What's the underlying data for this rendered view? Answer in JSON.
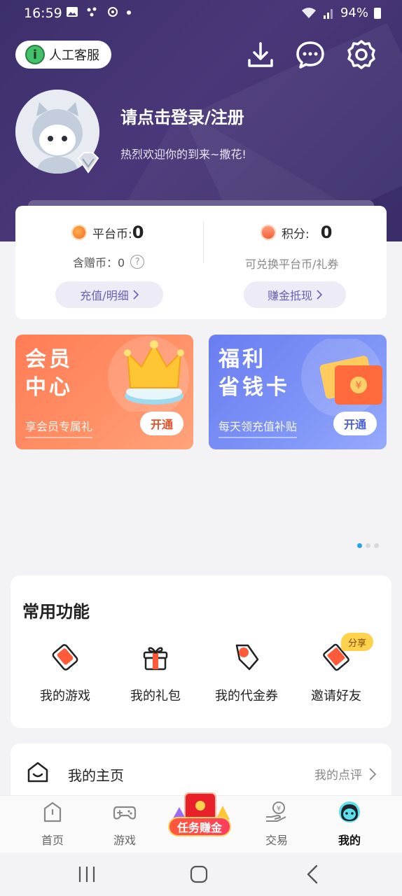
{
  "status_bar": {
    "time": "16:59",
    "battery": "94%",
    "left_icons": [
      "image-icon",
      "dots-icon",
      "vpn-icon",
      "dot-icon"
    ],
    "right_icons": [
      "wifi-icon",
      "signal-icon",
      "battery-icon"
    ]
  },
  "header": {
    "customer_service_label": "人工客服",
    "icons": [
      "download-icon",
      "message-icon",
      "gear-icon"
    ]
  },
  "profile": {
    "login_title": "请点击登录/注册",
    "welcome": "热烈欢迎你的到来~撒花!"
  },
  "wallet": {
    "platform_coin_label": "平台币:",
    "platform_coin_value": "0",
    "gift_coin_label": "含赠币：0",
    "recharge_button": "充值/明细",
    "points_label": "积分:",
    "points_value": "0",
    "exchange_hint": "可兑换平台币/礼券",
    "cash_button": "赚金抵现"
  },
  "banners": {
    "member": {
      "title_line1": "会员",
      "title_line2": "中心",
      "subtitle": "享会员专属礼",
      "button": "开通"
    },
    "welfare": {
      "title_line1": "福利",
      "title_line2": "省钱卡",
      "subtitle": "每天领充值补贴",
      "button": "开通"
    }
  },
  "common_functions": {
    "title": "常用功能",
    "items": [
      {
        "label": "我的游戏",
        "icon": "game-card-icon"
      },
      {
        "label": "我的礼包",
        "icon": "gift-icon"
      },
      {
        "label": "我的代金券",
        "icon": "voucher-tag-icon"
      },
      {
        "label": "邀请好友",
        "icon": "invite-envelope-icon"
      }
    ],
    "share_badge": "分享"
  },
  "homepage_row": {
    "label": "我的主页",
    "review_link": "我的点评"
  },
  "bottom_nav": {
    "items": [
      {
        "label": "首页",
        "icon": "home-icon"
      },
      {
        "label": "游戏",
        "icon": "gamepad-icon"
      },
      {
        "label": "任务赚金",
        "icon": "task-redpacket-icon"
      },
      {
        "label": "交易",
        "icon": "trade-icon"
      },
      {
        "label": "我的",
        "icon": "profile-face-icon"
      }
    ],
    "active": "我的"
  },
  "colors": {
    "header_purple": "#3d2f6b",
    "accent_purple": "#6b5fb5",
    "member_orange": "#ff7c56",
    "welfare_blue": "#6a7df1",
    "pager_active": "#29a3e8"
  }
}
